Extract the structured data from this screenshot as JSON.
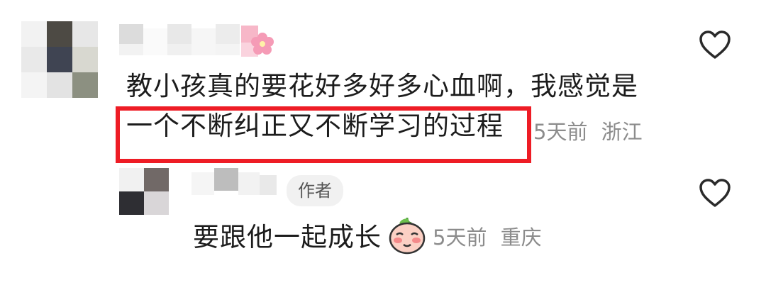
{
  "comment": {
    "line1": "教小孩真的要花好多好多心血啊，我感觉是",
    "line2": "一个不断纠正又不断学习的过程",
    "time": "5天前",
    "location": "浙江",
    "like_icon": "heart-outline-icon",
    "name_emoji": "cherry-blossom-icon"
  },
  "reply": {
    "author_badge": "作者",
    "text": "要跟他一起成长",
    "emoji": "blushing-face-sticker",
    "time": "5天前",
    "location": "重庆",
    "like_icon": "heart-outline-icon"
  },
  "colors": {
    "highlight": "#ee1c25",
    "meta_text": "#8c8c8c",
    "badge_bg": "#f1f1f1"
  }
}
